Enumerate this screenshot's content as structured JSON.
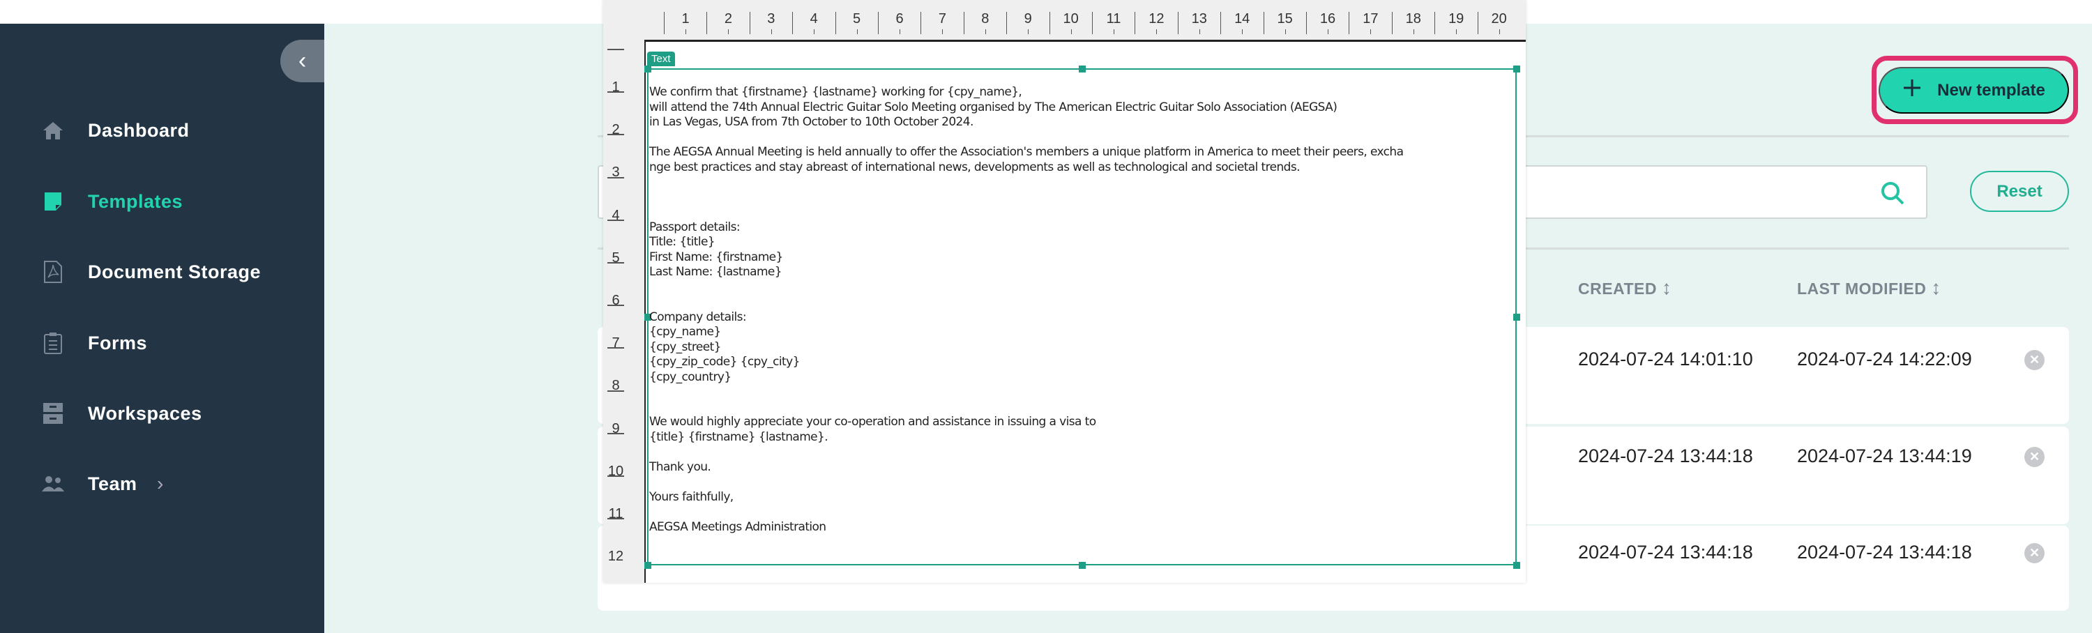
{
  "sidebar": {
    "collapse_icon": "chevron-left-icon",
    "items": [
      {
        "label": "Dashboard",
        "icon": "home-icon"
      },
      {
        "label": "Templates",
        "icon": "template-icon",
        "active": true
      },
      {
        "label": "Document Storage",
        "icon": "pdf-icon"
      },
      {
        "label": "Forms",
        "icon": "clipboard-icon"
      },
      {
        "label": "Workspaces",
        "icon": "archive-icon"
      },
      {
        "label": "Team",
        "icon": "users-icon",
        "chevron": "chevron-right-icon"
      }
    ]
  },
  "toolbar": {
    "new_template_label": "New template",
    "reset_label": "Reset"
  },
  "search": {
    "value": "",
    "placeholder": ""
  },
  "table": {
    "headers": {
      "created": "CREATED",
      "last_modified": "LAST MODIFIED"
    },
    "rows": [
      {
        "created": "2024-07-24 14:01:10",
        "last_modified": "2024-07-24 14:22:09"
      },
      {
        "created": "2024-07-24 13:44:18",
        "last_modified": "2024-07-24 13:44:19"
      },
      {
        "created": "2024-07-24 13:44:18",
        "last_modified": "2024-07-24 13:44:18"
      }
    ]
  },
  "preview": {
    "ruler_top": [
      "1",
      "2",
      "3",
      "4",
      "5",
      "6",
      "7",
      "8",
      "9",
      "10",
      "11",
      "12",
      "13",
      "14",
      "15",
      "16",
      "17",
      "18",
      "19",
      "20"
    ],
    "ruler_left": [
      "1",
      "2",
      "3",
      "4",
      "5",
      "6",
      "7",
      "8",
      "9",
      "10",
      "11",
      "12"
    ],
    "text_label": "Text",
    "body": "We confirm that {firstname} {lastname} working for {cpy_name},\nwill attend the 74th Annual Electric Guitar Solo Meeting organised by The American Electric Guitar Solo Association (AEGSA)\nin Las Vegas, USA from 7th October to 10th October 2024.\n\nThe AEGSA Annual Meeting is held annually to offer the Association's members a unique platform in America to meet their peers, excha\nnge best practices and stay abreast of international news, developments as well as technological and societal trends.\n\n\n\nPassport details:\nTitle: {title}\nFirst Name: {firstname}\nLast Name: {lastname}\n\n\nCompany details:\n{cpy_name}\n{cpy_street}\n{cpy_zip_code} {cpy_city}\n{cpy_country}\n\n\nWe would highly appreciate your co-operation and assistance in issuing a visa to\n{title} {firstname} {lastname}.\n\nThank you.\n\nYours faithfully,\n\nAEGSA Meetings Administration"
  },
  "colors": {
    "sidebar": "#233545",
    "accent": "#22d3b0",
    "highlight": "#e0306e",
    "background": "#e8f4f1"
  }
}
